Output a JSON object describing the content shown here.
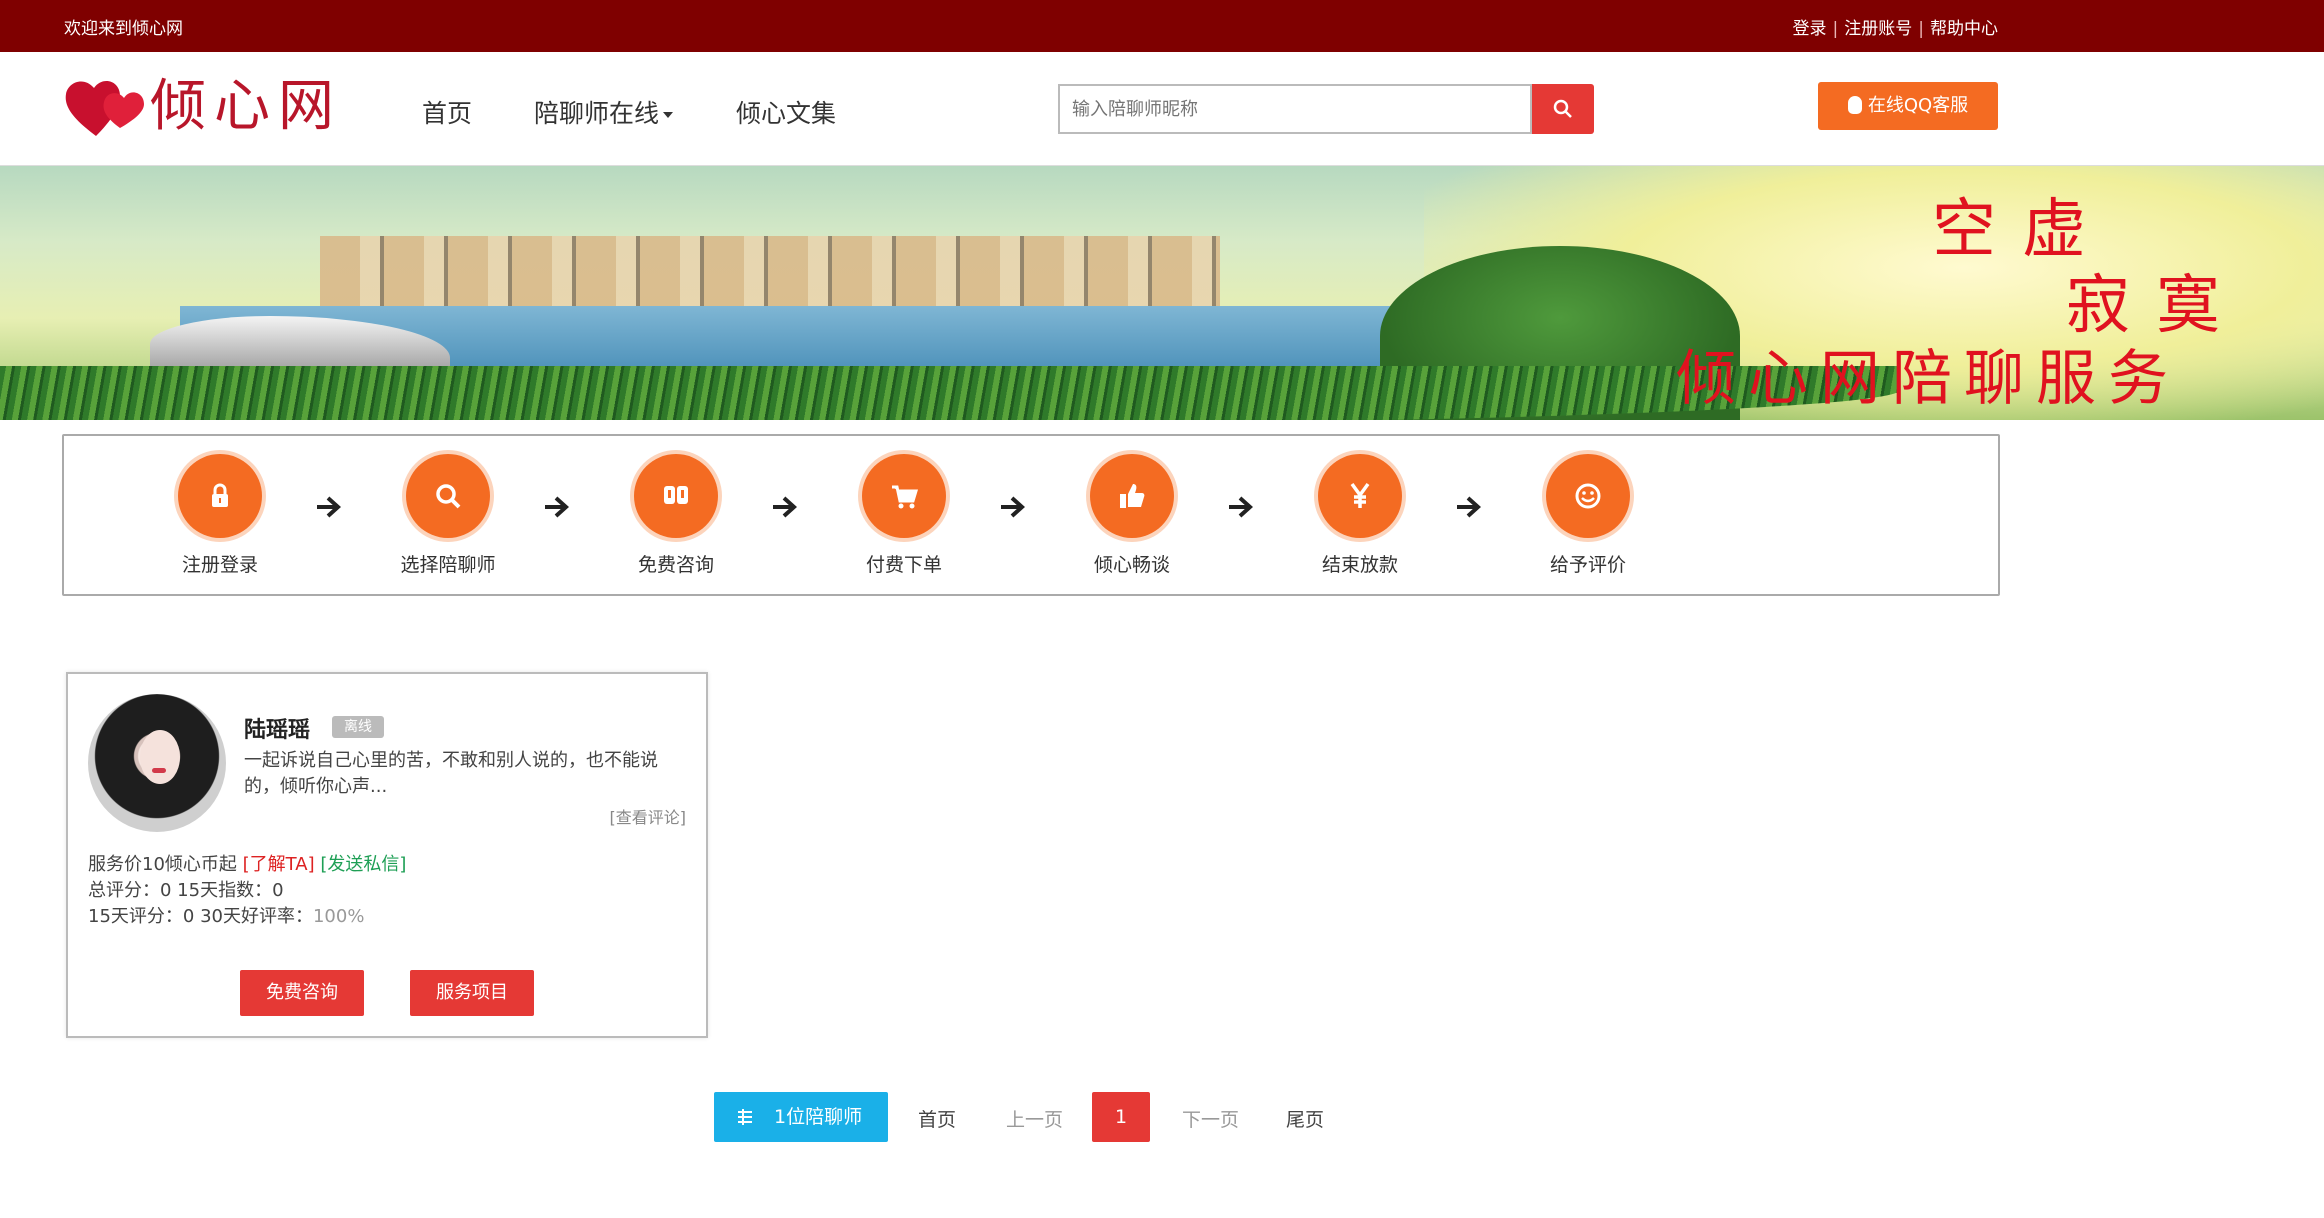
{
  "topbar": {
    "welcome": "欢迎来到倾心网",
    "links": [
      "登录",
      "注册账号",
      "帮助中心"
    ],
    "separator": "|"
  },
  "header": {
    "logo_text": "倾心网",
    "nav": [
      {
        "label": "首页"
      },
      {
        "label": "陪聊师在线"
      },
      {
        "label": "倾心文集"
      }
    ],
    "search": {
      "value": "",
      "placeholder": "输入陪聊师昵称"
    },
    "qq_button": "在线QQ客服"
  },
  "banner": {
    "slogan_line1": "空虚",
    "slogan_line2": "寂寞",
    "slogan_line3": "倾心网陪聊服务"
  },
  "steps": [
    {
      "label": "注册登录",
      "icon": "lock-icon"
    },
    {
      "label": "选择陪聊师",
      "icon": "search-icon"
    },
    {
      "label": "免费咨询",
      "icon": "chat-icon"
    },
    {
      "label": "付费下单",
      "icon": "cart-icon"
    },
    {
      "label": "倾心畅谈",
      "icon": "thumb-icon"
    },
    {
      "label": "结束放款",
      "icon": "yen-icon"
    },
    {
      "label": "给予评价",
      "icon": "smile-icon"
    }
  ],
  "card": {
    "name": "陆瑶瑶",
    "badge": "离线",
    "intro": "一起诉说自己心里的苦，不敢和别人说的，也不能说的，倾听你心声...",
    "review_link": "[查看评论]",
    "price_prefix": "服务价10倾心币起 ",
    "link_about": "[了解TA]",
    "link_message": "[发送私信]",
    "score_line": "总评分：0 15天指数：0",
    "rating_prefix": "15天评分：0 30天好评率：",
    "rating_pct": "100%",
    "btn_consult": "免费咨询",
    "btn_buy": "服务项目"
  },
  "pager": {
    "count": "1位陪聊师",
    "first": "首页",
    "prev": "上一页",
    "current": "1",
    "next": "下一页",
    "last": "尾页"
  },
  "colors": {
    "topbar": "#7f0000",
    "accent": "#e53935",
    "orange": "#f46b22",
    "blue": "#1ab0e8"
  }
}
